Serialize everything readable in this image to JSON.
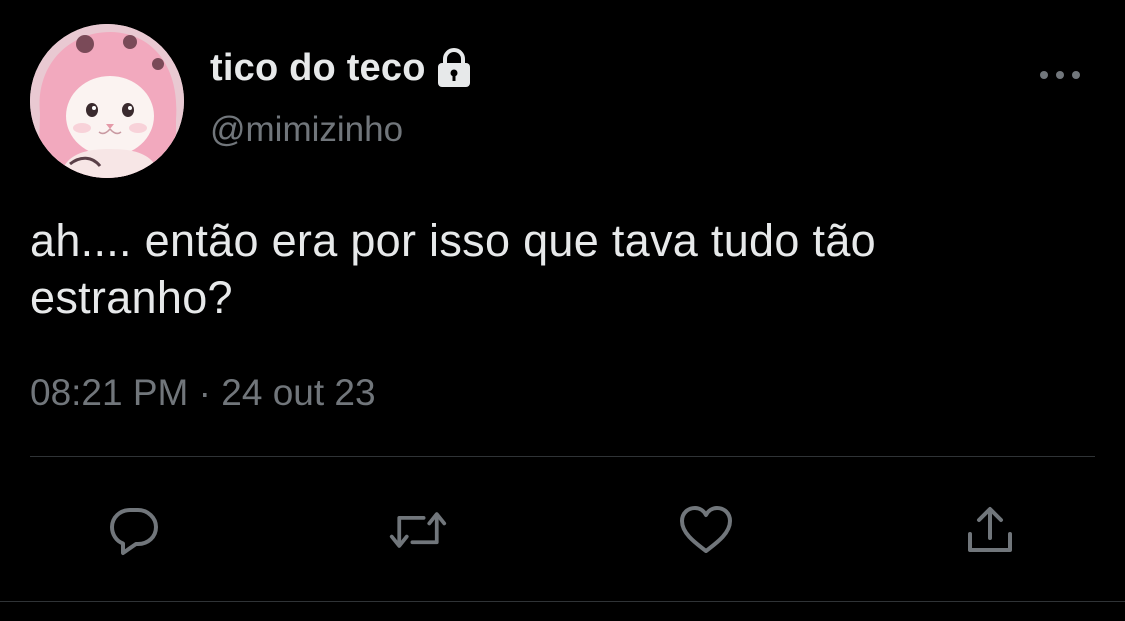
{
  "author": {
    "display_name": "tico do teco",
    "handle": "@mimizinho",
    "protected_icon": "lock-icon",
    "avatar": "cat-in-pink-hood-avatar"
  },
  "tweet": {
    "text_lines": [
      "ah.... então era por isso que tava tudo tão",
      "estranho?"
    ],
    "time": "08:21 PM",
    "separator": "·",
    "date": "24 out 23"
  },
  "actions": {
    "more": "more-icon",
    "reply": "reply-icon",
    "retweet": "retweet-icon",
    "like": "heart-icon",
    "share": "share-icon"
  },
  "colors": {
    "background": "#000000",
    "text_primary": "#e7e9ea",
    "text_secondary": "#71767b",
    "divider": "#2f3336"
  }
}
